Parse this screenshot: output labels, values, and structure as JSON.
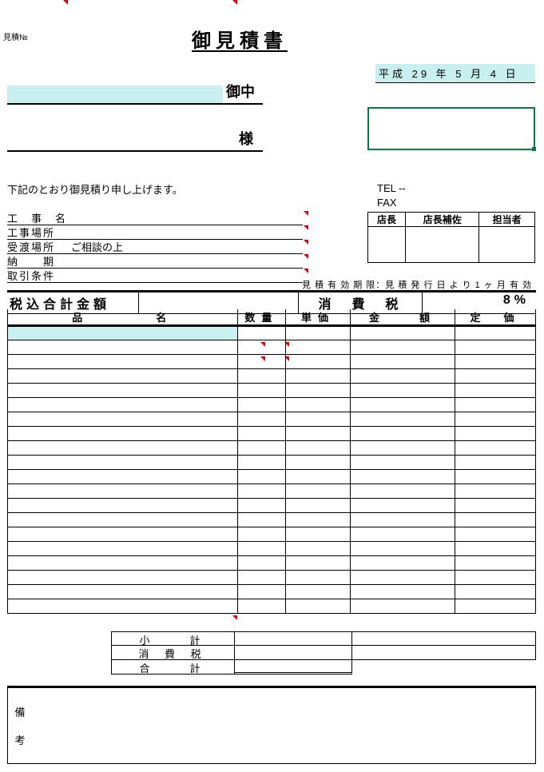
{
  "header": {
    "estimate_no_label": "見積№",
    "title": "御見積書",
    "date": "平成 29 年 5 月 4 日"
  },
  "recipient": {
    "company_suffix": "御中",
    "person_suffix": "様"
  },
  "intro_text": "下記のとおり御見積り申し上げます。",
  "contact": {
    "tel_label": "TEL --",
    "fax_label": "FAX"
  },
  "details": {
    "rows": [
      {
        "label": "工　事　名",
        "value": ""
      },
      {
        "label": "工事場所",
        "value": ""
      },
      {
        "label": "受渡場所",
        "value": "ご相談の上"
      },
      {
        "label": "納　　期",
        "value": ""
      },
      {
        "label": "取引条件",
        "value": ""
      }
    ]
  },
  "approval": {
    "headers": [
      "店長",
      "店長補佐",
      "担当者"
    ]
  },
  "validity_note": "見 積 有 効 期 限：見 積 発 行 日 よ り 1 ヶ 月 有 効",
  "totals_bar": {
    "total_label": "税込合計金額",
    "tax_label": "消　費　税",
    "tax_rate": "8%"
  },
  "items_table": {
    "headers": {
      "name": "品　　　　名",
      "qty": "数量",
      "unit_price": "単価",
      "amount": "金　　額",
      "list_price": "定　価"
    },
    "row_count": 20
  },
  "summary": {
    "subtotal": "小　　計",
    "tax": "消 費 税",
    "total": "合　　計"
  },
  "remarks": {
    "label_top": "備",
    "label_bottom": "考"
  }
}
